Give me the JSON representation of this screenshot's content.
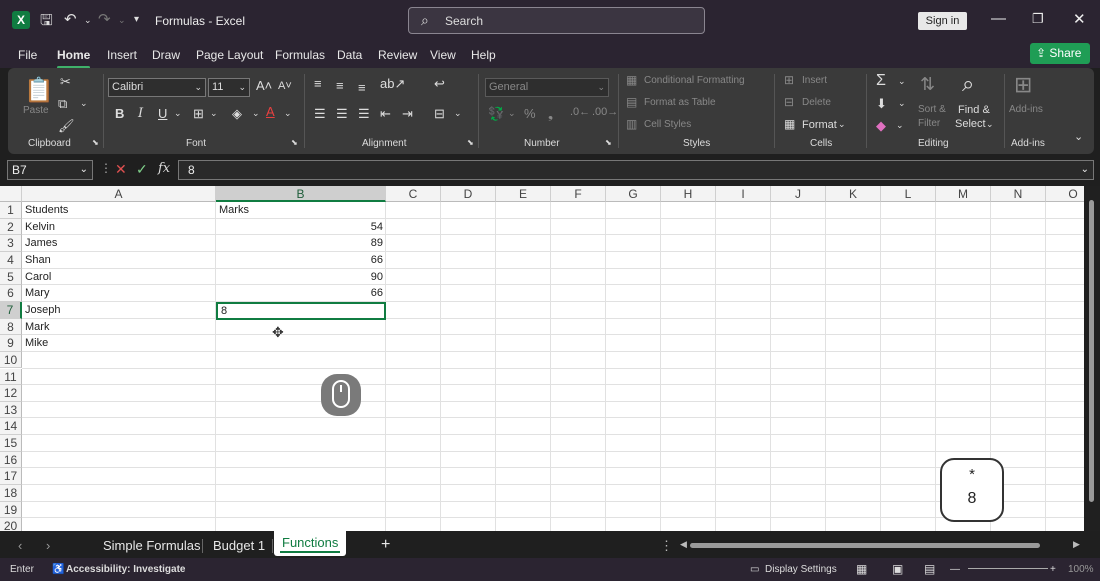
{
  "window": {
    "title": "Formulas  -  Excel",
    "search_placeholder": "Search",
    "sign_in": "Sign in"
  },
  "menu": {
    "items": [
      "File",
      "Home",
      "Insert",
      "Draw",
      "Page Layout",
      "Formulas",
      "Data",
      "Review",
      "View",
      "Help"
    ],
    "active": "Home",
    "share": "Share"
  },
  "ribbon": {
    "clipboard": {
      "label": "Clipboard",
      "paste": "Paste"
    },
    "font": {
      "label": "Font",
      "name": "Calibri",
      "size": "11"
    },
    "alignment": {
      "label": "Alignment"
    },
    "number": {
      "label": "Number",
      "format": "General"
    },
    "styles": {
      "label": "Styles",
      "conditional": "Conditional Formatting",
      "table": "Format as Table",
      "cell_styles": "Cell Styles"
    },
    "cells": {
      "label": "Cells",
      "insert": "Insert",
      "delete": "Delete",
      "format": "Format"
    },
    "editing": {
      "label": "Editing",
      "sort_filter_1": "Sort &",
      "sort_filter_2": "Filter",
      "find_1": "Find &",
      "find_2": "Select"
    },
    "addins": {
      "label": "Add-ins",
      "button": "Add-ins"
    }
  },
  "formula_bar": {
    "name_box": "B7",
    "value": "8"
  },
  "sheet": {
    "columns": [
      "A",
      "B",
      "C",
      "D",
      "E",
      "F",
      "G",
      "H",
      "I",
      "J",
      "K",
      "L",
      "M",
      "N",
      "O"
    ],
    "rows": [
      "1",
      "2",
      "3",
      "4",
      "5",
      "6",
      "7",
      "8",
      "9",
      "10",
      "11",
      "12",
      "13",
      "14",
      "15",
      "16",
      "17",
      "18",
      "19",
      "20"
    ],
    "col_a": [
      "Students",
      "Kelvin",
      "James",
      "Shan",
      "Carol",
      "Mary",
      "Joseph",
      "Mark",
      "Mike"
    ],
    "col_b": [
      "Marks",
      "54",
      "89",
      "66",
      "90",
      "66"
    ],
    "active_cell_value": "8"
  },
  "key_overlay": {
    "top": "*",
    "bottom": "8"
  },
  "tabs": {
    "items": [
      "Simple Formulas",
      "Budget 1",
      "Functions"
    ],
    "active": "Functions",
    "add": "+"
  },
  "status": {
    "mode": "Enter",
    "accessibility": "Accessibility: Investigate",
    "display_settings": "Display Settings",
    "zoom": "100%"
  }
}
